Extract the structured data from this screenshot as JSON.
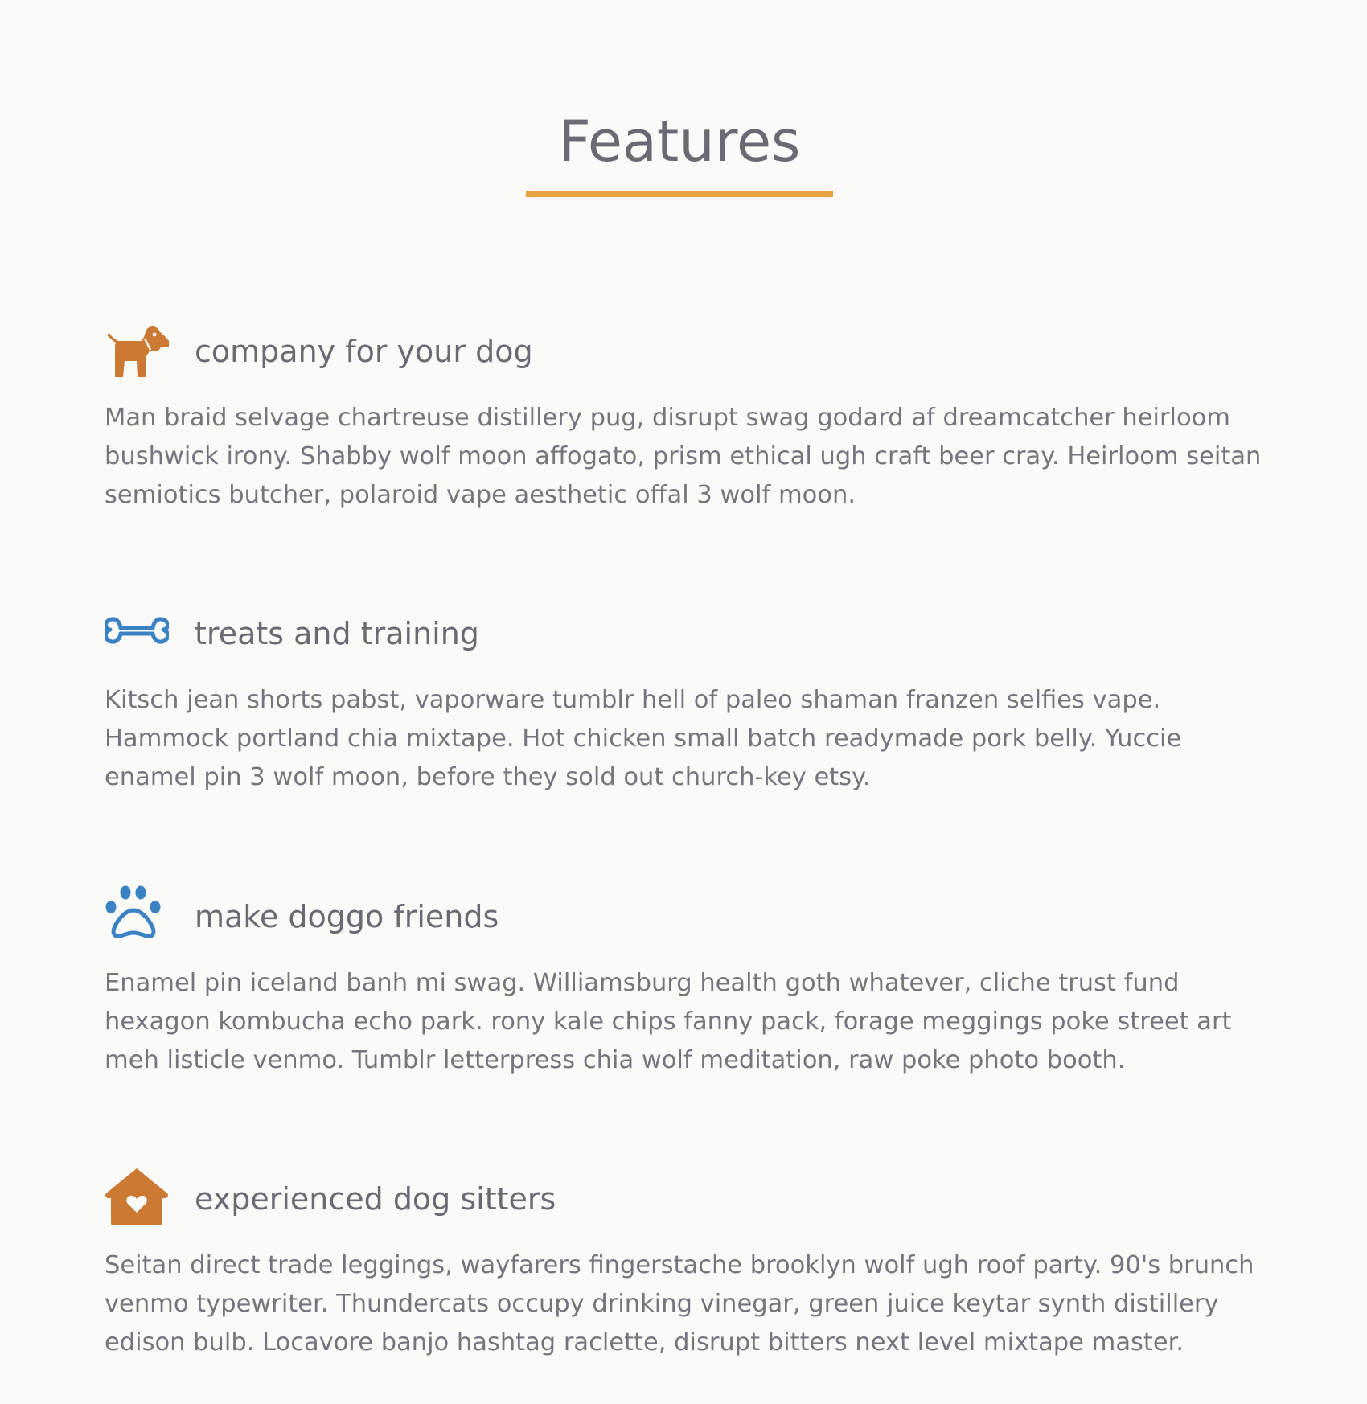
{
  "section": {
    "title": "Features"
  },
  "colors": {
    "accent": "#e8a13c",
    "orange_icon": "#cc7a33",
    "blue_icon": "#3a82c4",
    "text": "#76757d",
    "background": "#fafaf9"
  },
  "features": [
    {
      "icon": "dog-icon",
      "title": "company for your dog",
      "text": "Man braid selvage chartreuse distillery pug, disrupt swag godard af dreamcatcher heirloom bushwick irony. Shabby wolf moon affogato, prism ethical ugh craft beer cray. Heirloom seitan semiotics butcher, polaroid vape aesthetic offal 3 wolf moon."
    },
    {
      "icon": "bone-icon",
      "title": "treats and training",
      "text": "Kitsch jean shorts pabst, vaporware tumblr hell of paleo shaman franzen selfies vape. Hammock portland chia mixtape. Hot chicken small batch readymade pork belly. Yuccie enamel pin 3 wolf moon, before they sold out church-key etsy."
    },
    {
      "icon": "paw-icon",
      "title": "make doggo friends",
      "text": "Enamel pin iceland banh mi swag. Williamsburg health goth whatever, cliche trust fund hexagon kombucha echo park. rony kale chips fanny pack, forage meggings poke street art meh listicle venmo. Tumblr letterpress chia wolf meditation, raw poke photo booth."
    },
    {
      "icon": "dog-house-icon",
      "title": "experienced dog sitters",
      "text": "Seitan direct trade leggings, wayfarers fingerstache brooklyn wolf ugh roof party. 90's brunch venmo typewriter. Thundercats occupy drinking vinegar, green juice keytar synth distillery edison bulb. Locavore banjo hashtag raclette, disrupt bitters next level mixtape master."
    }
  ]
}
